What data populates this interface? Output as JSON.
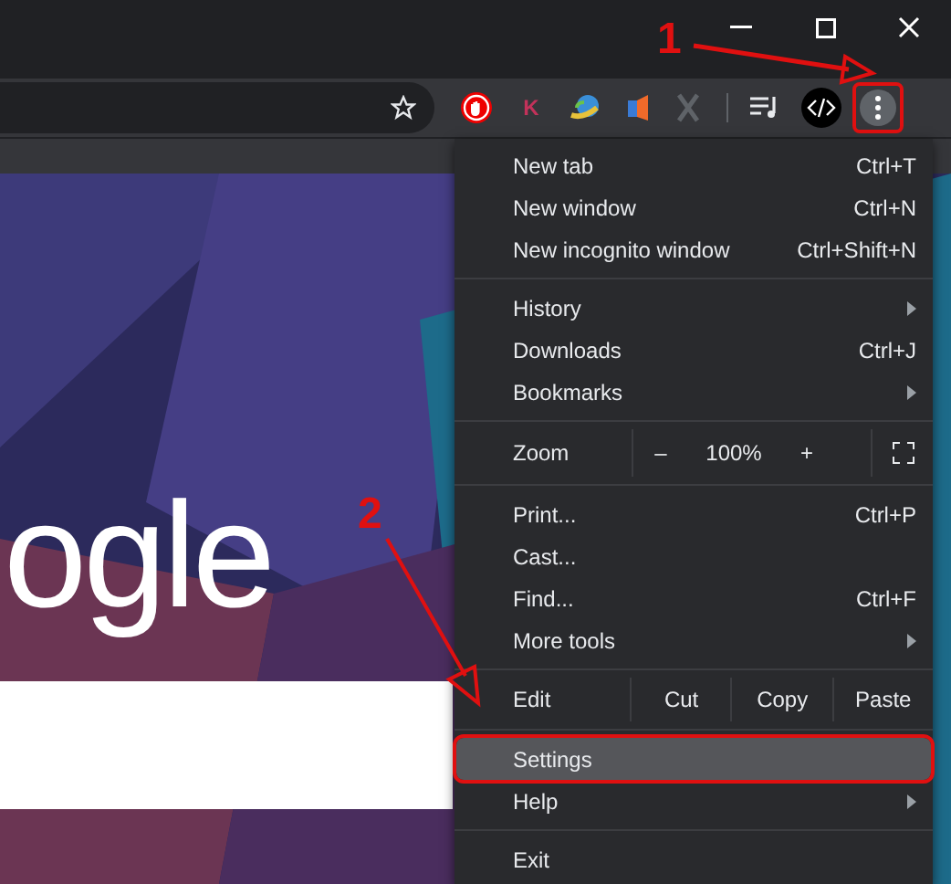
{
  "window_controls": [
    {
      "kind": "minimize"
    },
    {
      "kind": "maximize"
    },
    {
      "kind": "close"
    }
  ],
  "toolbar": {
    "extensions": [
      {
        "kind": "hand"
      },
      {
        "kind": "letter",
        "label": "K"
      },
      {
        "kind": "globe"
      },
      {
        "kind": "flag"
      },
      {
        "kind": "x-mark"
      }
    ],
    "media": {
      "kind": "playlist"
    },
    "devtools": {
      "kind": "code"
    },
    "menu_button": {
      "highlighted": true
    }
  },
  "page": {
    "logo": "ogle"
  },
  "menu": [
    {
      "kind": "item",
      "label": "New tab",
      "shortcut": "Ctrl+T",
      "submenu": false,
      "selected": false
    },
    {
      "kind": "item",
      "label": "New window",
      "shortcut": "Ctrl+N",
      "submenu": false,
      "selected": false
    },
    {
      "kind": "item",
      "label": "New incognito window",
      "shortcut": "Ctrl+Shift+N",
      "submenu": false,
      "selected": false
    },
    {
      "kind": "separator"
    },
    {
      "kind": "item",
      "label": "History",
      "submenu": true,
      "selected": false
    },
    {
      "kind": "item",
      "label": "Downloads",
      "shortcut": "Ctrl+J",
      "submenu": false,
      "selected": false
    },
    {
      "kind": "item",
      "label": "Bookmarks",
      "submenu": true,
      "selected": false
    },
    {
      "kind": "separator"
    },
    {
      "kind": "zoom",
      "label": "Zoom",
      "minus": "–",
      "value": "100%",
      "plus": "+"
    },
    {
      "kind": "separator"
    },
    {
      "kind": "item",
      "label": "Print...",
      "shortcut": "Ctrl+P",
      "submenu": false,
      "selected": false
    },
    {
      "kind": "item",
      "label": "Cast...",
      "submenu": false,
      "selected": false
    },
    {
      "kind": "item",
      "label": "Find...",
      "shortcut": "Ctrl+F",
      "submenu": false,
      "selected": false
    },
    {
      "kind": "item",
      "label": "More tools",
      "submenu": true,
      "selected": false
    },
    {
      "kind": "separator"
    },
    {
      "kind": "edit",
      "label": "Edit",
      "buttons": [
        "Cut",
        "Copy",
        "Paste"
      ]
    },
    {
      "kind": "separator"
    },
    {
      "kind": "item",
      "label": "Settings",
      "submenu": false,
      "selected": true
    },
    {
      "kind": "item",
      "label": "Help",
      "submenu": true,
      "selected": false
    },
    {
      "kind": "separator"
    },
    {
      "kind": "item",
      "label": "Exit",
      "submenu": false,
      "selected": false
    }
  ],
  "annotations": [
    {
      "label": "1"
    },
    {
      "label": "2"
    }
  ]
}
